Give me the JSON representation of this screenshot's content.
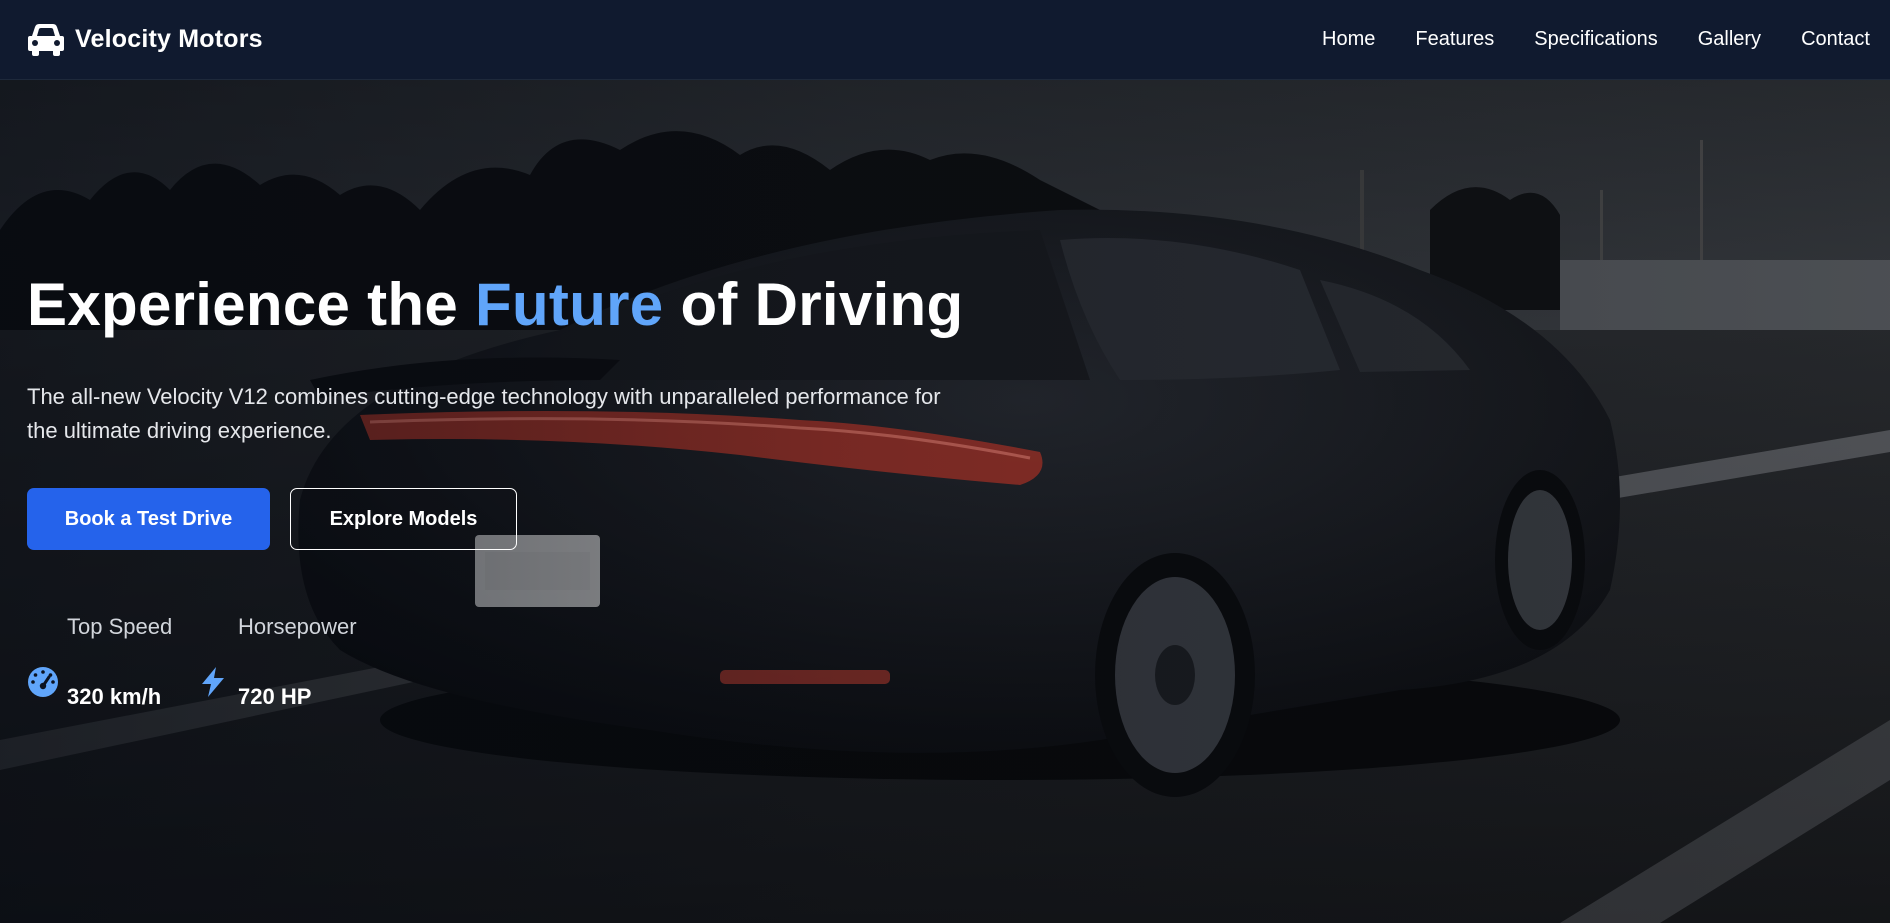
{
  "brand": {
    "name": "Velocity Motors",
    "icon": "car-icon"
  },
  "nav": {
    "items": [
      {
        "label": "Home"
      },
      {
        "label": "Features"
      },
      {
        "label": "Specifications"
      },
      {
        "label": "Gallery"
      },
      {
        "label": "Contact"
      }
    ]
  },
  "hero": {
    "title_part1": "Experience the ",
    "title_accent": "Future",
    "title_part2": " of Driving",
    "description": "The all-new Velocity V12 combines cutting-edge technology with unparalleled performance for the ultimate driving experience.",
    "primary_button": "Book a Test Drive",
    "secondary_button": "Explore Models",
    "background": "car-rear-photo",
    "stats": [
      {
        "label": "Top Speed",
        "value": "320 km/h",
        "icon": "speedometer-icon"
      },
      {
        "label": "Horsepower",
        "value": "720 HP",
        "icon": "lightning-bolt-icon"
      }
    ]
  },
  "colors": {
    "navbar_bg": "#101a2f",
    "accent": "#60a5fa",
    "primary_button": "#2563eb",
    "text": "#ffffff"
  }
}
